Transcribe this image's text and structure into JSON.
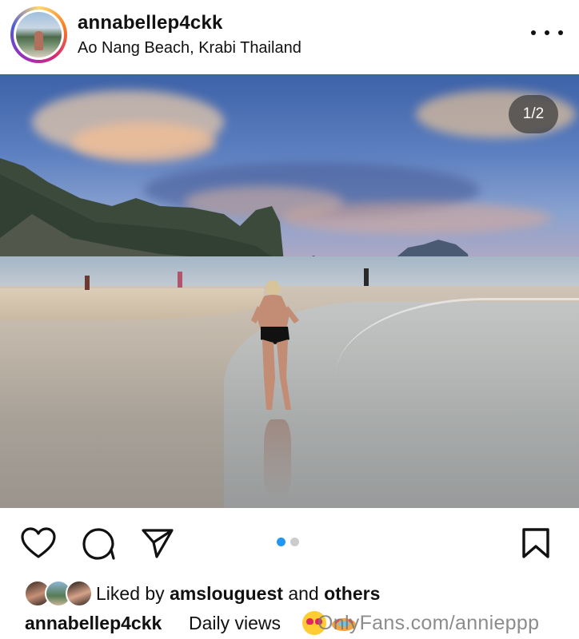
{
  "post": {
    "username": "annabellep4ckk",
    "location": "Ao Nang Beach, Krabi Thailand",
    "image_counter": "1/2",
    "carousel": {
      "total": 2,
      "active_index": 0
    }
  },
  "likes": {
    "prefix": "Liked by ",
    "user": "amslouguest",
    "middle": " and ",
    "others": "others"
  },
  "caption": {
    "username": "annabellep4ckk",
    "text": "Daily views",
    "emojis": [
      "heart-eyes-emoji",
      "float-ring-emoji"
    ]
  },
  "watermark": "OnlyFans.com/annieppp",
  "icons": {
    "more": "more-options-icon",
    "like": "heart-icon",
    "comment": "comment-icon",
    "share": "send-icon",
    "save": "bookmark-icon"
  },
  "colors": {
    "carousel_active": "#2196f3",
    "carousel_inactive": "#cccccc",
    "counter_bg": "#3c3c3c"
  }
}
